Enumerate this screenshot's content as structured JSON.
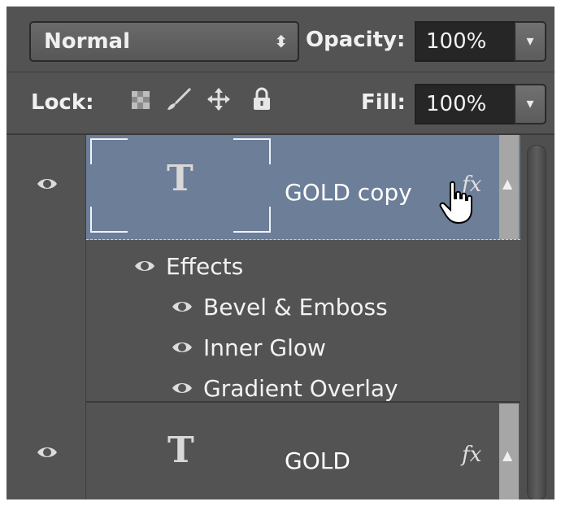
{
  "blend_mode": {
    "value": "Normal"
  },
  "opacity": {
    "label": "Opacity:",
    "value": "100%"
  },
  "lock": {
    "label": "Lock:",
    "icons": [
      "transparent-pixels-lock-icon",
      "paint-brush-lock-icon",
      "move-lock-icon",
      "padlock-icon"
    ]
  },
  "fill": {
    "label": "Fill:",
    "value": "100%"
  },
  "layers": [
    {
      "name": "GOLD copy",
      "type_glyph": "T",
      "fx": "fx",
      "selected": true
    },
    {
      "name": "GOLD",
      "type_glyph": "T",
      "fx": "fx",
      "selected": false
    }
  ],
  "effects": {
    "header": "Effects",
    "items": [
      "Bevel & Emboss",
      "Inner Glow",
      "Gradient Overlay"
    ]
  },
  "colors": {
    "panel": "#535353",
    "selection": "#6c7e98",
    "field": "#262626"
  }
}
